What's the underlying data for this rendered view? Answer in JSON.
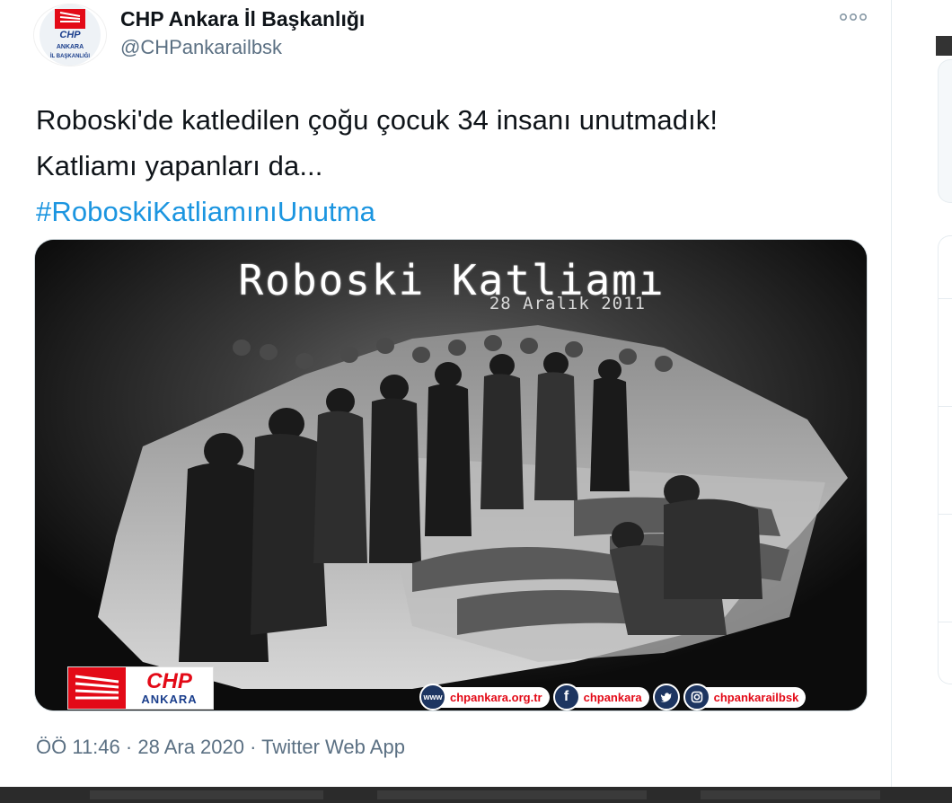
{
  "author": {
    "name": "CHP Ankara İl Başkanlığı",
    "handle": "@CHPankarailbsk",
    "avatar_text_top": "CHP",
    "avatar_text_mid": "ANKARA",
    "avatar_text_bottom": "İL BAŞKANLIĞI"
  },
  "tweet": {
    "line1": "Roboski'de katledilen çoğu çocuk 34 insanı unutmadık!",
    "line2": "Katliamı yapanları da...",
    "hashtag": "#RoboskiKatliamınıUnutma"
  },
  "media": {
    "title": "Roboski Katliamı",
    "date": "28 Aralık 2011",
    "logo_chp": "CHP",
    "logo_ankara": "ANKARA",
    "social": [
      {
        "icon": "www",
        "label": "chpankara.org.tr"
      },
      {
        "icon": "f",
        "label": "chpankara"
      },
      {
        "icon": "twitter-bird",
        "label": ""
      },
      {
        "icon": "instagram",
        "label": "chpankarailbsk"
      }
    ]
  },
  "meta": {
    "time": "ÖÖ 11:46",
    "separator1": " · ",
    "date": "28 Ara 2020",
    "separator2": " · ",
    "app": "Twitter Web App"
  },
  "colors": {
    "chp_red": "#e30a17",
    "link_blue": "#1b95e0",
    "secondary_text": "#5b7083"
  }
}
